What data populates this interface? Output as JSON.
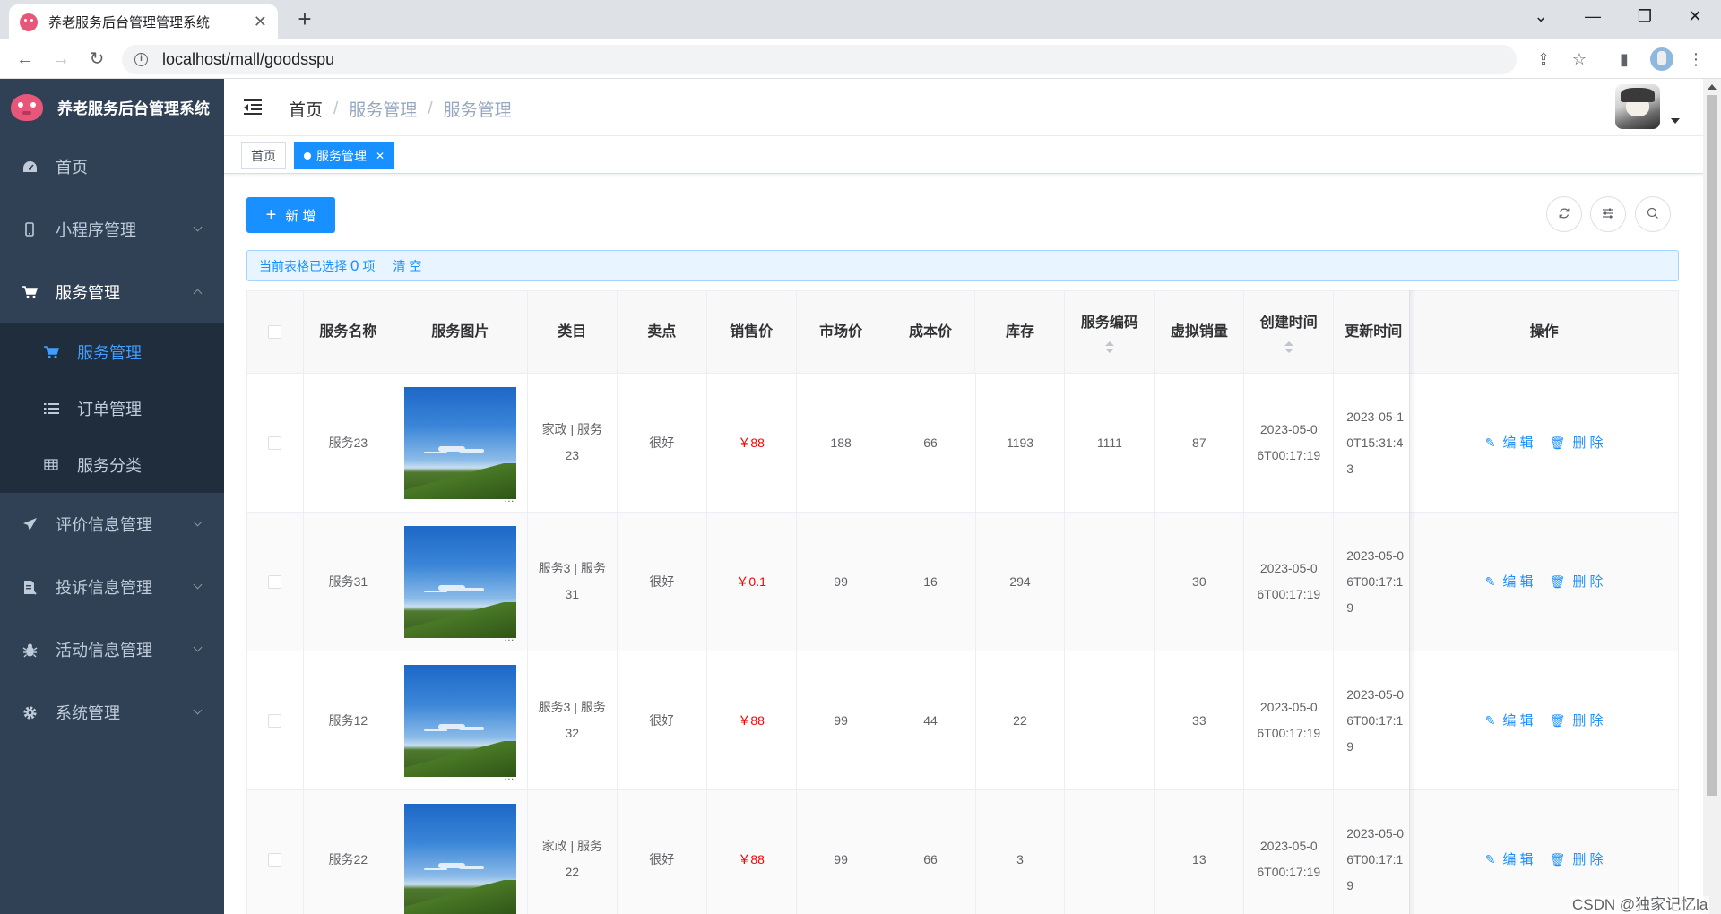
{
  "browser": {
    "tab_title": "养老服务后台管理管理系统",
    "url": "localhost/mall/goodsspu"
  },
  "sidebar": {
    "title": "养老服务后台管理系统",
    "items": [
      {
        "label": "首页",
        "icon": "dashboard-icon"
      },
      {
        "label": "小程序管理",
        "icon": "mobile-icon"
      },
      {
        "label": "服务管理",
        "icon": "cart-icon",
        "children": [
          {
            "label": "服务管理",
            "icon": "cart-icon",
            "active": true
          },
          {
            "label": "订单管理",
            "icon": "list-icon"
          },
          {
            "label": "服务分类",
            "icon": "table-icon"
          }
        ]
      },
      {
        "label": "评价信息管理",
        "icon": "send-icon"
      },
      {
        "label": "投诉信息管理",
        "icon": "document-icon"
      },
      {
        "label": "活动信息管理",
        "icon": "bug-icon"
      },
      {
        "label": "系统管理",
        "icon": "gear-icon"
      }
    ]
  },
  "header": {
    "breadcrumb": [
      "首页",
      "服务管理",
      "服务管理"
    ]
  },
  "tags": {
    "home": "首页",
    "active": "服务管理"
  },
  "toolbar": {
    "add_label": "新 增"
  },
  "alert": {
    "prefix": "当前表格已选择",
    "count": "0",
    "suffix": "项",
    "clear": "清 空"
  },
  "table": {
    "columns": [
      "服务名称",
      "服务图片",
      "类目",
      "卖点",
      "销售价",
      "市场价",
      "成本价",
      "库存",
      "服务编码",
      "虚拟销量",
      "创建时间",
      "更新时间",
      "操作"
    ],
    "rows": [
      {
        "name": "服务23",
        "category": "家政 | 服务23",
        "selling_point": "很好",
        "sale_price": "￥88",
        "market_price": "188",
        "cost_price": "66",
        "stock": "1193",
        "code": "1111",
        "virtual_sales": "87",
        "created": "2023-05-06T00:17:19",
        "updated": "2023-05-10T15:31:43"
      },
      {
        "name": "服务31",
        "category": "服务3 | 服务31",
        "selling_point": "很好",
        "sale_price": "￥0.1",
        "market_price": "99",
        "cost_price": "16",
        "stock": "294",
        "code": "",
        "virtual_sales": "30",
        "created": "2023-05-06T00:17:19",
        "updated": "2023-05-06T00:17:19"
      },
      {
        "name": "服务12",
        "category": "服务3 | 服务32",
        "selling_point": "很好",
        "sale_price": "￥88",
        "market_price": "99",
        "cost_price": "44",
        "stock": "22",
        "code": "",
        "virtual_sales": "33",
        "created": "2023-05-06T00:17:19",
        "updated": "2023-05-06T00:17:19"
      },
      {
        "name": "服务22",
        "category": "家政 | 服务22",
        "selling_point": "很好",
        "sale_price": "￥88",
        "market_price": "99",
        "cost_price": "66",
        "stock": "3",
        "code": "",
        "virtual_sales": "13",
        "created": "2023-05-06T00:17:19",
        "updated": "2023-05-06T00:17:19"
      }
    ],
    "edit_label": "编 辑",
    "delete_label": "删 除"
  },
  "watermark": "CSDN @独家记忆la"
}
